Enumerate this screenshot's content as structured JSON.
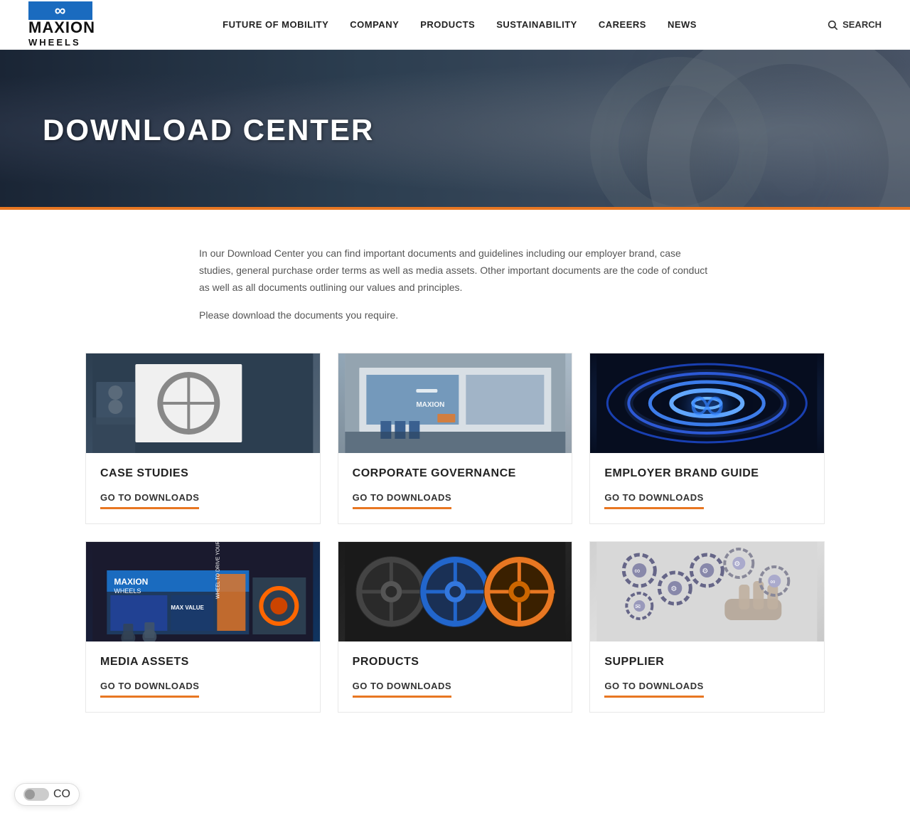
{
  "header": {
    "logo": {
      "infinity_symbol": "∞",
      "name": "MAXION",
      "subtitle": "WHEELS"
    },
    "nav": {
      "items": [
        {
          "label": "FUTURE OF MOBILITY",
          "id": "future-of-mobility"
        },
        {
          "label": "COMPANY",
          "id": "company"
        },
        {
          "label": "PRODUCTS",
          "id": "products"
        },
        {
          "label": "SUSTAINABILITY",
          "id": "sustainability"
        },
        {
          "label": "CAREERS",
          "id": "careers"
        },
        {
          "label": "NEWS",
          "id": "news"
        }
      ]
    },
    "search_label": "SEARCH"
  },
  "hero": {
    "title": "DOWNLOAD CENTER"
  },
  "intro": {
    "paragraph1": "In our Download Center you can find important documents and guidelines including our employer brand, case studies, general purchase order terms as well as media assets. Other important documents are the code of conduct as well as all documents outlining our values and principles.",
    "paragraph2": "Please download the documents you require."
  },
  "cards": [
    {
      "id": "case-studies",
      "title": "CASE STUDIES",
      "link_label": "GO TO DOWNLOADS",
      "image_type": "case"
    },
    {
      "id": "corporate-governance",
      "title": "CORPORATE GOVERNANCE",
      "link_label": "GO TO DOWNLOADS",
      "image_type": "corporate"
    },
    {
      "id": "employer-brand-guide",
      "title": "EMPLOYER BRAND GUIDE",
      "link_label": "GO TO DOWNLOADS",
      "image_type": "employer"
    },
    {
      "id": "media-assets",
      "title": "MEDIA ASSETS",
      "link_label": "GO TO DOWNLOADS",
      "image_type": "media"
    },
    {
      "id": "products",
      "title": "PRODUCTS",
      "link_label": "GO TO DOWNLOADS",
      "image_type": "products"
    },
    {
      "id": "supplier",
      "title": "SUPPLIER",
      "link_label": "GO TO DOWNLOADS",
      "image_type": "supplier"
    }
  ],
  "cookie": {
    "toggle_label": "CO"
  }
}
